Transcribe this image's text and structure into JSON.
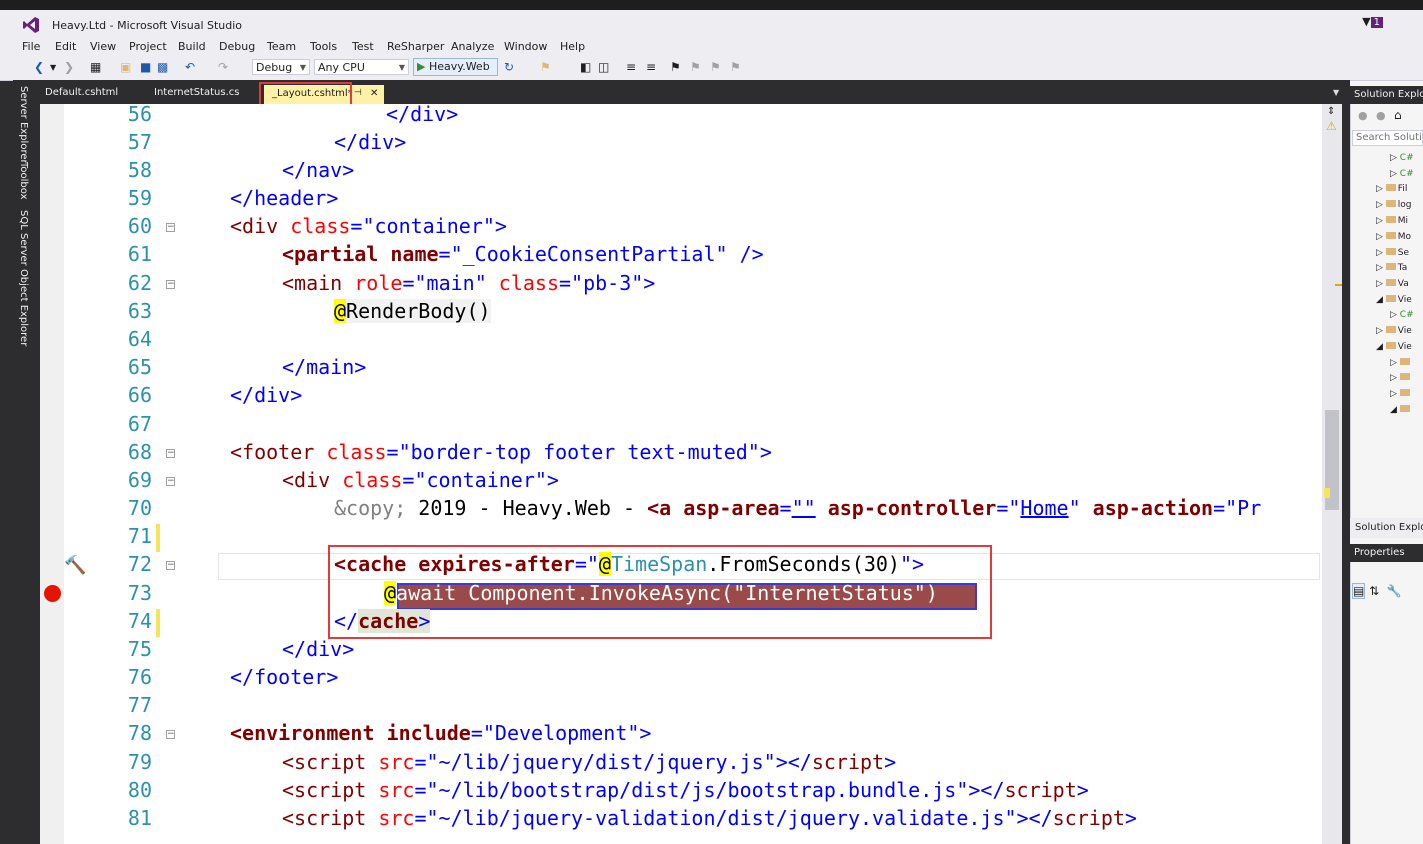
{
  "window": {
    "title": "Heavy.Ltd - Microsoft Visual Studio",
    "notification_count": "1"
  },
  "menu": [
    "File",
    "Edit",
    "View",
    "Project",
    "Build",
    "Debug",
    "Team",
    "Tools",
    "Test",
    "ReSharper",
    "Analyze",
    "Window",
    "Help"
  ],
  "toolbar": {
    "configuration": "Debug",
    "platform": "Any CPU",
    "run_target": "Heavy.Web"
  },
  "side_rail": [
    "Server Explorer",
    "Toolbox",
    "SQL Server Object Explorer"
  ],
  "tabs": [
    {
      "label": "Default.cshtml",
      "active": false
    },
    {
      "label": "InternetStatus.cs",
      "active": false
    },
    {
      "label": "_Layout.cshtml*",
      "active": true
    }
  ],
  "editor": {
    "line_numbers": [
      "56",
      "57",
      "58",
      "59",
      "60",
      "61",
      "62",
      "63",
      "64",
      "65",
      "66",
      "67",
      "68",
      "69",
      "70",
      "71",
      "72",
      "73",
      "74",
      "75",
      "76",
      "77",
      "78",
      "79",
      "80",
      "81"
    ],
    "line56": "</div>",
    "line57": "</div>",
    "line58": "</nav>",
    "line59": "</header>",
    "line60": [
      "<div",
      " class",
      "=",
      "\"container\"",
      ">"
    ],
    "line61": [
      "<partial",
      " name",
      "=",
      "\"_CookieConsentPartial\"",
      " />"
    ],
    "line62": [
      "<main",
      " role",
      "=",
      "\"main\"",
      " class",
      "=",
      "\"pb-3\"",
      ">"
    ],
    "line63": [
      "@",
      "RenderBody()"
    ],
    "line65": "</main>",
    "line66": "</div>",
    "line68": [
      "<footer",
      " class",
      "=",
      "\"border-top footer text-muted\"",
      ">"
    ],
    "line69": [
      "<div",
      " class",
      "=",
      "\"container\"",
      ">"
    ],
    "line70": [
      "&copy;",
      " 2019 - Heavy.Web - ",
      "<a",
      " asp-area",
      "=",
      "\"\"",
      " asp-controller",
      "=",
      "\"",
      "Home",
      "\"",
      " asp-action",
      "=",
      "\"Pr"
    ],
    "line72": [
      "<cache",
      " expires-after",
      "=",
      "\"",
      "@",
      "TimeSpan",
      ".FromSeconds(30)",
      "\"",
      ">"
    ],
    "line73": [
      "@",
      "await Component.InvokeAsync(\"InternetStatus\")"
    ],
    "line74": [
      "</",
      "cache",
      ">"
    ],
    "line75": "</div>",
    "line76": "</footer>",
    "line78": [
      "<environment",
      " include",
      "=",
      "\"Development\"",
      ">"
    ],
    "line79": [
      "<script",
      " src",
      "=",
      "\"~/lib/jquery/dist/jquery.js\"",
      "></",
      "script",
      ">"
    ],
    "line80": [
      "<script",
      " src",
      "=",
      "\"~/lib/bootstrap/dist/js/bootstrap.bundle.js\"",
      "></",
      "script",
      ">"
    ],
    "line81": [
      "<script",
      " src",
      "=",
      "\"~/lib/jquery-validation/dist/jquery.validate.js\"",
      "></",
      "script",
      ">"
    ]
  },
  "solution_explorer": {
    "title": "Solution Explorer",
    "search_placeholder": "Search Solution Explorer",
    "items": [
      "C#",
      "C#",
      "Fil",
      "log",
      "Mi",
      "Mo",
      "Se",
      "Ta",
      "Va",
      "Vie",
      "C#",
      "Vie",
      "Vie",
      "",
      "",
      "",
      ""
    ],
    "bottom_tab": "Solution Explorer"
  },
  "properties": {
    "title": "Properties"
  }
}
